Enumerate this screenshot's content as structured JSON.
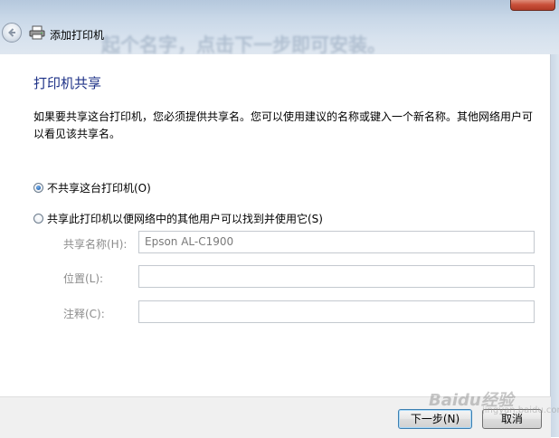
{
  "window": {
    "title": "添加打印机",
    "background_text": "起个名字，点击下一步即可安装。"
  },
  "page": {
    "heading": "打印机共享",
    "description": "如果要共享这台打印机，您必须提供共享名。您可以使用建议的名称或键入一个新名称。其他网络用户可以看见该共享名。"
  },
  "options": [
    {
      "label": "不共享这台打印机(O)",
      "checked": true
    },
    {
      "label": "共享此打印机以便网络中的其他用户可以找到并使用它(S)",
      "checked": false
    }
  ],
  "fields": [
    {
      "label": "共享名称(H):",
      "value": "Epson AL-C1900"
    },
    {
      "label": "位置(L):",
      "value": ""
    },
    {
      "label": "注释(C):",
      "value": ""
    }
  ],
  "buttons": {
    "next": "下一步(N)",
    "cancel": "取消"
  },
  "watermark": {
    "brand": "Baidu经验",
    "url": "jingyan.baidu.com"
  },
  "colors": {
    "heading": "#1e3287",
    "disabled_text": "#8c8c8c",
    "close_button": "#c9503a"
  }
}
